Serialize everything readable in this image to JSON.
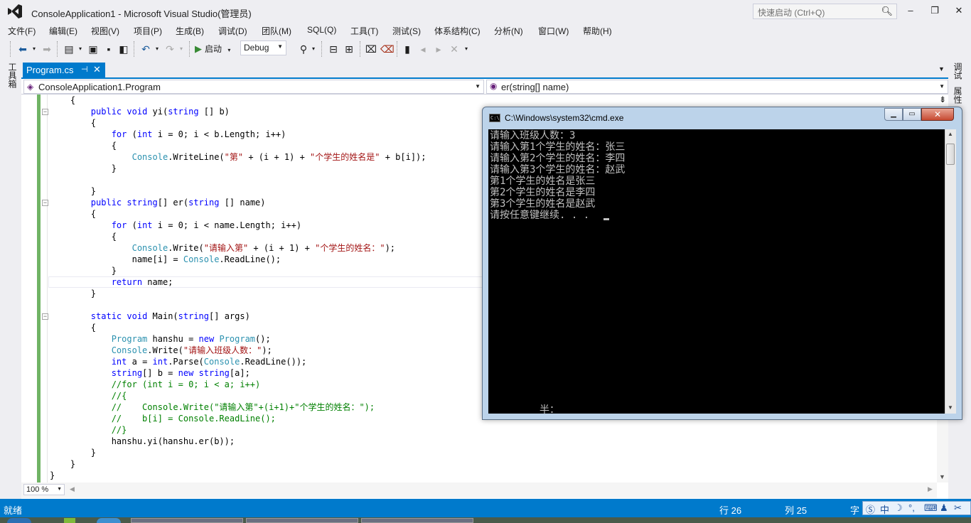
{
  "window": {
    "title": "ConsoleApplication1 - Microsoft Visual Studio(管理员)",
    "quick_launch_placeholder": "快速启动 (Ctrl+Q)",
    "minimize": "–",
    "maximize": "❐",
    "close": "✕"
  },
  "menu": [
    "文件(F)",
    "编辑(E)",
    "视图(V)",
    "项目(P)",
    "生成(B)",
    "调试(D)",
    "团队(M)",
    "SQL(Q)",
    "工具(T)",
    "测试(S)",
    "体系结构(C)",
    "分析(N)",
    "窗口(W)",
    "帮助(H)"
  ],
  "toolbar": {
    "start_label": "启动",
    "configuration": "Debug"
  },
  "side_tabs": {
    "left": "工具箱",
    "right_top": "调试",
    "right_bottom": "属性"
  },
  "document_tab": {
    "label": "Program.cs",
    "pin": "⊣",
    "close": "✕"
  },
  "navigation": {
    "class_selector": "ConsoleApplication1.Program",
    "member_selector": "er(string[] name)"
  },
  "code_lines": [
    "    {",
    "        public void yi(string [] b)",
    "        {",
    "            for (int i = 0; i < b.Length; i++)",
    "            {",
    "                Console.WriteLine(\"第\" + (i + 1) + \"个学生的姓名是\" + b[i]);",
    "            }",
    "",
    "        }",
    "        public string[] er(string [] name)",
    "        {",
    "            for (int i = 0; i < name.Length; i++)",
    "            {",
    "                Console.Write(\"请输入第\" + (i + 1) + \"个学生的姓名：\");",
    "                name[i] = Console.ReadLine();",
    "            }",
    "            return name;",
    "        }",
    "",
    "        static void Main(string[] args)",
    "        {",
    "            Program hanshu = new Program();",
    "            Console.Write(\"请输入班级人数：\");",
    "            int a = int.Parse(Console.ReadLine());",
    "            string[] b = new string[a];",
    "            //for (int i = 0; i < a; i++)",
    "            //{",
    "            //    Console.Write(\"请输入第\"+(i+1)+\"个学生的姓名：\");",
    "            //    b[i] = Console.ReadLine();",
    "            //}",
    "            hanshu.yi(hanshu.er(b));",
    "        }",
    "    }",
    "}"
  ],
  "editor": {
    "zoom": "100 %"
  },
  "status": {
    "text": "就绪",
    "line": "行 26",
    "col": "列 25",
    "ch": "字"
  },
  "ime": {
    "zh": "中",
    "moon": "☽",
    "punct": "°,",
    "kbd": "⌨",
    "person": "♟",
    "tools": "✂",
    "logo": "Ⓢ"
  },
  "cmd": {
    "title": "C:\\Windows\\system32\\cmd.exe",
    "icon_text": "C:\\",
    "lines": [
      "请输入班级人数：3",
      "请输入第1个学生的姓名：张三",
      "请输入第2个学生的姓名：李四",
      "请输入第3个学生的姓名：赵武",
      "第1个学生的姓名是张三",
      "第2个学生的姓名是李四",
      "第3个学生的姓名是赵武",
      "请按任意键继续. . ."
    ],
    "ime_indicator": "半："
  }
}
